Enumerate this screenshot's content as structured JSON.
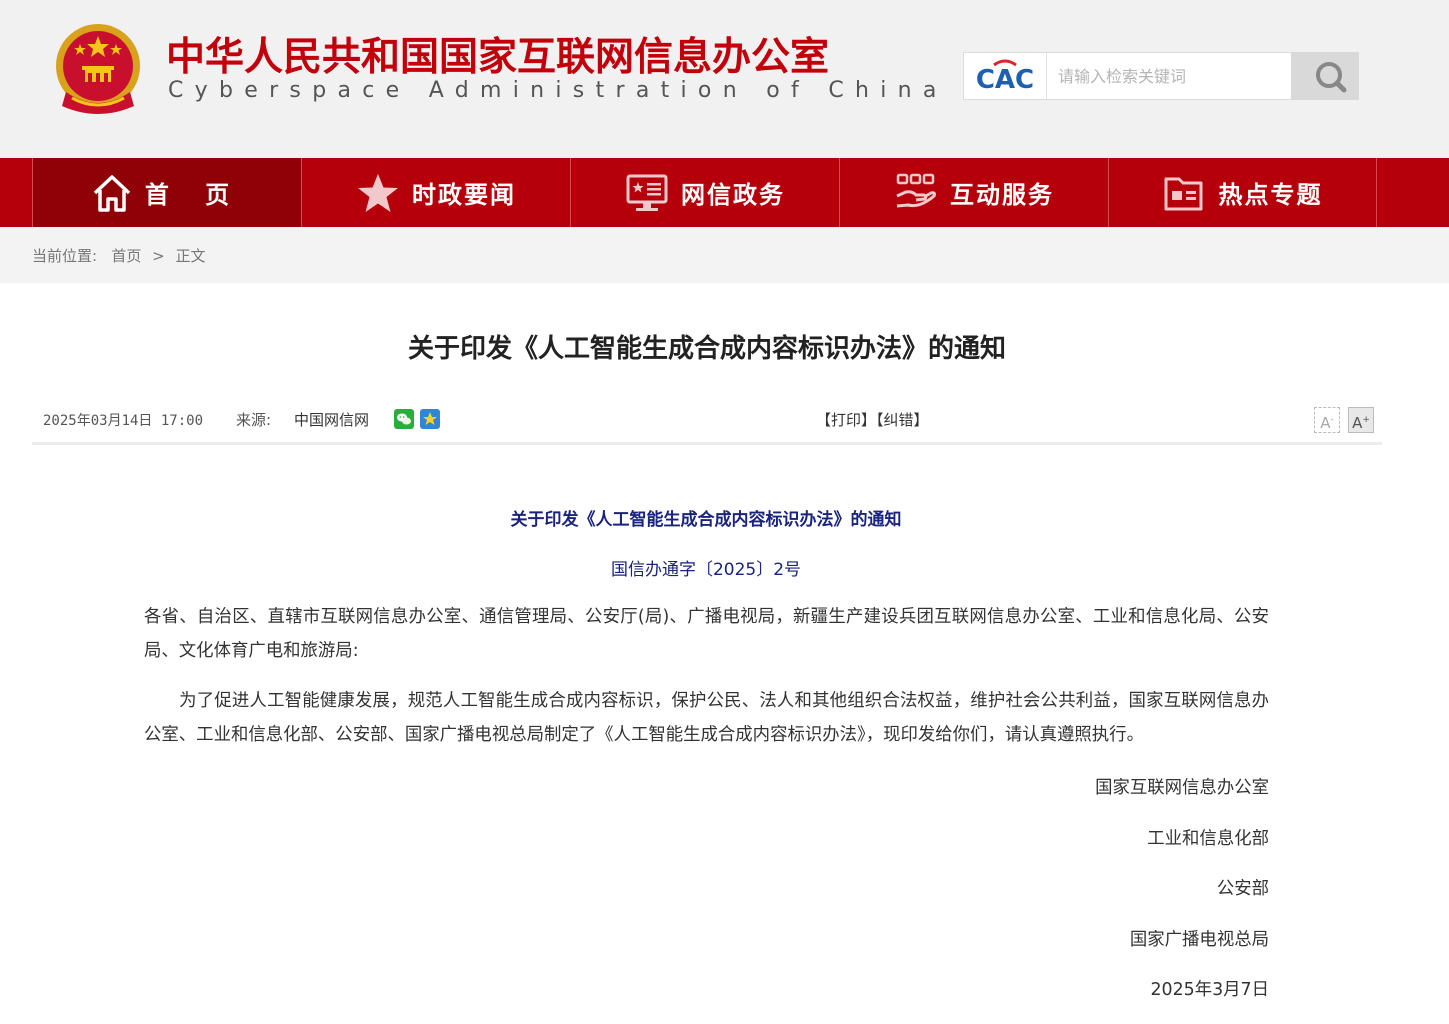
{
  "header": {
    "site_title": "中华人民共和国国家互联网信息办公室",
    "site_subtitle": "Cyberspace Administration of China",
    "logo_text": "CAC",
    "search_placeholder": "请输入检索关键词"
  },
  "nav": {
    "items": [
      {
        "label": "首 页",
        "icon": "home-icon"
      },
      {
        "label": "时政要闻",
        "icon": "star-icon"
      },
      {
        "label": "网信政务",
        "icon": "monitor-icon"
      },
      {
        "label": "互动服务",
        "icon": "hands-icon"
      },
      {
        "label": "热点专题",
        "icon": "folder-icon"
      }
    ]
  },
  "breadcrumb": {
    "label": "当前位置:",
    "home": "首页",
    "separator": ">",
    "current": "正文"
  },
  "article": {
    "title": "关于印发《人工智能生成合成内容标识办法》的通知",
    "date": "2025年03月14日  17:00",
    "source_label": "来源:",
    "source": "中国网信网",
    "print": "【打印】",
    "correct": "【纠错】",
    "font_smaller": "A",
    "font_larger": "A",
    "doc_heading": "关于印发《人工智能生成合成内容标识办法》的通知",
    "doc_number": "国信办通字〔2025〕2号",
    "para1": "各省、自治区、直辖市互联网信息办公室、通信管理局、公安厅(局)、广播电视局，新疆生产建设兵团互联网信息办公室、工业和信息化局、公安局、文化体育广电和旅游局:",
    "para2": "　　为了促进人工智能健康发展，规范人工智能生成合成内容标识，保护公民、法人和其他组织合法权益，维护社会公共利益，国家互联网信息办公室、工业和信息化部、公安部、国家广播电视总局制定了《人工智能生成合成内容标识办法》，现印发给你们，请认真遵照执行。",
    "signatories": [
      "国家互联网信息办公室",
      "工业和信息化部",
      "公安部",
      "国家广播电视总局"
    ],
    "sign_date": "2025年3月7日"
  },
  "colors": {
    "brand_red": "#b5000b",
    "nav_active": "#8f0007",
    "doc_blue": "#1a237e"
  }
}
